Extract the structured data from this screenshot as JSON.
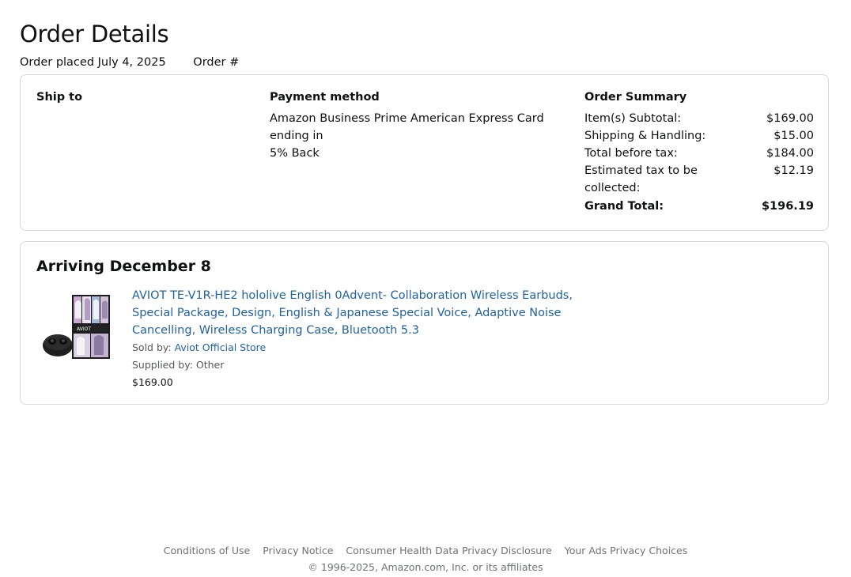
{
  "page": {
    "title": "Order Details",
    "order_placed": "Order placed July 4, 2025",
    "order_number_label": "Order #"
  },
  "ship_to": {
    "heading": "Ship to"
  },
  "payment": {
    "heading": "Payment method",
    "card_text": "Amazon Business Prime American Express Card  ending in",
    "reward": "5% Back"
  },
  "summary": {
    "heading": "Order Summary",
    "rows": [
      {
        "label": "Item(s) Subtotal:",
        "value": "$169.00"
      },
      {
        "label": "Shipping & Handling:",
        "value": "$15.00"
      },
      {
        "label": "Total before tax:",
        "value": "$184.00"
      },
      {
        "label": "Estimated tax to be collected:",
        "value": "$12.19"
      }
    ],
    "grand_total_label": "Grand Total:",
    "grand_total_value": "$196.19"
  },
  "shipment": {
    "arrival": "Arriving December 8",
    "item": {
      "title": "AVIOT TE-V1R-HE2 hololive English 0Advent- Collaboration Wireless Earbuds, Special Package, Design, English & Japanese Special Voice, Adaptive Noise Cancelling, Wireless Charging Case, Bluetooth 5.3",
      "sold_by_label": "Sold by:",
      "sold_by_store": "Aviot Official Store",
      "supplied_by": "Supplied by: Other",
      "price": "$169.00"
    }
  },
  "footer": {
    "links": [
      "Conditions of Use",
      "Privacy Notice",
      "Consumer Health Data Privacy Disclosure",
      "Your Ads Privacy Choices"
    ],
    "copyright": "© 1996-2025, Amazon.com, Inc. or its affiliates"
  },
  "colors": {
    "link": "#2162a1",
    "border": "#d5d9d9",
    "muted": "#565959",
    "footer": "#6f7373"
  }
}
